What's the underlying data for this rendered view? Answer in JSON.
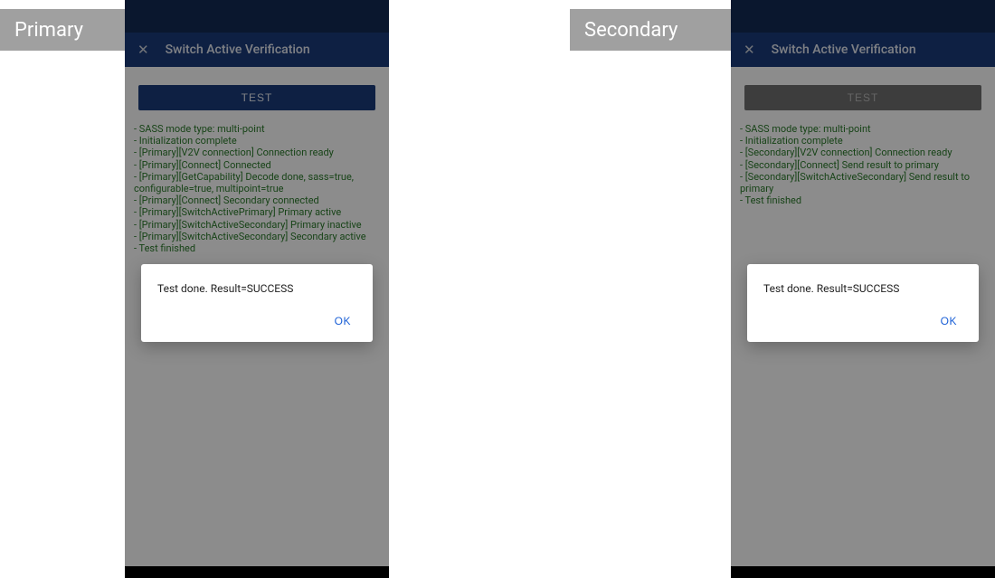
{
  "labels": {
    "primary_badge": "Primary",
    "secondary_badge": "Secondary"
  },
  "primary": {
    "app_bar": {
      "title": "Switch Active Verification"
    },
    "test_button": {
      "label": "TEST",
      "disabled": false
    },
    "log": [
      "- SASS mode type: multi-point",
      "- Initialization complete",
      "- [Primary][V2V connection] Connection ready",
      "- [Primary][Connect] Connected",
      "- [Primary][GetCapability] Decode done, sass=true, configurable=true, multipoint=true",
      "- [Primary][Connect] Secondary connected",
      "- [Primary][SwitchActivePrimary] Primary active",
      "- [Primary][SwitchActiveSecondary] Primary inactive",
      "- [Primary][SwitchActiveSecondary] Secondary active",
      "- Test finished"
    ],
    "dialog": {
      "message": "Test done. Result=SUCCESS",
      "ok": "OK"
    }
  },
  "secondary": {
    "app_bar": {
      "title": "Switch Active Verification"
    },
    "test_button": {
      "label": "TEST",
      "disabled": true
    },
    "log": [
      "- SASS mode type: multi-point",
      "- Initialization complete",
      "- [Secondary][V2V connection] Connection ready",
      "- [Secondary][Connect] Send result to primary",
      "- [Secondary][SwitchActiveSecondary] Send result to primary",
      "- Test finished"
    ],
    "dialog": {
      "message": "Test done. Result=SUCCESS",
      "ok": "OK"
    }
  }
}
